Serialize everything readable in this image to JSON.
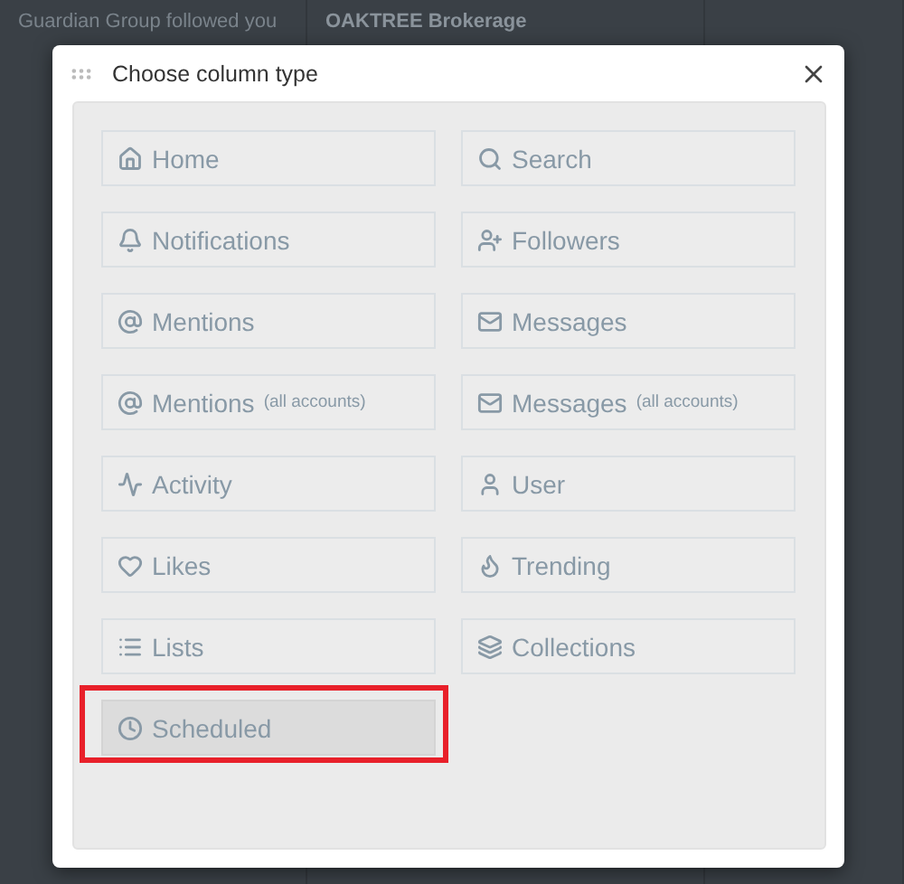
{
  "background": {
    "columns": [
      {
        "top": [
          {
            "kind": "meta",
            "text": "Guardian Group followed you"
          }
        ]
      },
      {
        "top": [
          {
            "kind": "name",
            "text": "OAKTREE Brokerage"
          }
        ]
      },
      {}
    ]
  },
  "dialog": {
    "title": "Choose column type",
    "buttons": [
      {
        "label": "Home",
        "selected": false,
        "highlighted": false
      },
      {
        "label": "Search",
        "selected": false,
        "highlighted": false
      },
      {
        "label": "Notifications",
        "selected": false,
        "highlighted": false
      },
      {
        "label": "Followers",
        "selected": false,
        "highlighted": false
      },
      {
        "label": "Mentions",
        "selected": false,
        "highlighted": false
      },
      {
        "label": "Messages",
        "selected": false,
        "highlighted": false
      },
      {
        "label": "Mentions",
        "note": "(all accounts)",
        "selected": false,
        "highlighted": false
      },
      {
        "label": "Messages",
        "note": "(all accounts)",
        "selected": false,
        "highlighted": false
      },
      {
        "label": "Activity",
        "selected": false,
        "highlighted": false
      },
      {
        "label": "User",
        "selected": false,
        "highlighted": false
      },
      {
        "label": "Likes",
        "selected": false,
        "highlighted": false
      },
      {
        "label": "Trending",
        "selected": false,
        "highlighted": false
      },
      {
        "label": "Lists",
        "selected": false,
        "highlighted": false
      },
      {
        "label": "Collections",
        "selected": false,
        "highlighted": false
      },
      {
        "label": "Scheduled",
        "selected": true,
        "highlighted": true
      }
    ]
  }
}
